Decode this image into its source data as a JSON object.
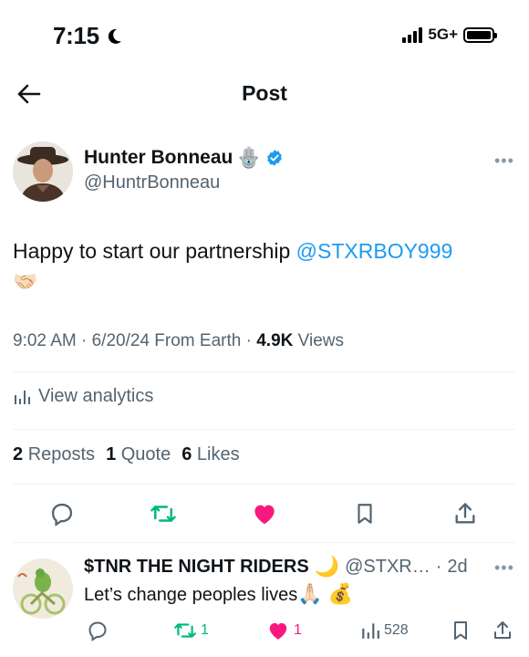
{
  "status_bar": {
    "time": "7:15",
    "network": "5G+"
  },
  "header": {
    "title": "Post"
  },
  "tweet": {
    "author_name": "Hunter Bonneau",
    "author_badge_emoji": "🪬",
    "author_handle": "@HuntrBonneau",
    "text_before": "Happy to start our partnership ",
    "mention": "@STXRBOY999",
    "text_emoji": "🤝🏻",
    "time": "9:02 AM",
    "date": "6/20/24",
    "source": "From Earth",
    "views_count": "4.9K",
    "views_label": "Views",
    "analytics_label": "View analytics",
    "reposts_count": "2",
    "reposts_label": "Reposts",
    "quotes_count": "1",
    "quotes_label": "Quote",
    "likes_count": "6",
    "likes_label": "Likes"
  },
  "reply": {
    "author_name": "$TNR THE NIGHT RIDERS",
    "name_emoji": "🌙",
    "handle": "@STXR…",
    "age": "2d",
    "text": "Let’s change peoples lives",
    "text_emoji": "🙏🏻 💰",
    "retweets": "1",
    "likes": "1",
    "views": "528"
  },
  "colors": {
    "accent": "#1d9bf0",
    "retweet": "#00ba7c",
    "like": "#f91880",
    "secondary": "#536471"
  },
  "icons": [
    "back-arrow-icon",
    "verified-icon",
    "more-icon",
    "analytics-icon",
    "reply-icon",
    "retweet-icon",
    "like-icon",
    "bookmark-icon",
    "share-icon"
  ]
}
